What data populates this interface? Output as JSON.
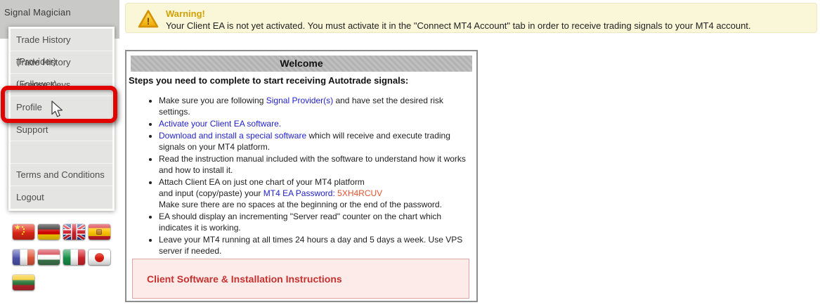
{
  "app": {
    "title": "Signal Magician"
  },
  "sidebar": {
    "items": [
      {
        "label": "Trade History (Provider)"
      },
      {
        "label": "Trade History (Follower)"
      },
      {
        "label": "License Keys"
      },
      {
        "label": "Profile",
        "highlighted": true
      },
      {
        "label": "Support"
      },
      {
        "label": ""
      },
      {
        "label": "Terms and Conditions"
      },
      {
        "label": "Logout"
      }
    ],
    "flags": [
      "china-flag-icon",
      "germany-flag-icon",
      "uk-flag-icon",
      "spain-flag-icon",
      "france-flag-icon",
      "hungary-flag-icon",
      "italy-flag-icon",
      "japan-flag-icon",
      "lithuania-flag-icon"
    ]
  },
  "warning": {
    "title": "Warning!",
    "message": "Your Client EA is not yet activated. You must activate it in the \"Connect MT4 Account\" tab in order to receive trading signals to your MT4 account."
  },
  "main": {
    "title": "Welcome",
    "intro": "Steps you need to complete to start receiving Autotrade signals:",
    "steps": [
      {
        "segments": [
          {
            "type": "text",
            "value": "Make sure you are following "
          },
          {
            "type": "link",
            "value": "Signal Provider(s)"
          },
          {
            "type": "text",
            "value": " and have set the desired risk settings."
          }
        ]
      },
      {
        "segments": [
          {
            "type": "link",
            "value": "Activate your Client EA software."
          }
        ]
      },
      {
        "segments": [
          {
            "type": "link",
            "value": "Download and install a special software"
          },
          {
            "type": "text",
            "value": " which will receive and execute trading signals on your MT4 platform."
          }
        ]
      },
      {
        "segments": [
          {
            "type": "text",
            "value": "Read the instruction manual included with the software to understand how it works and how to install it."
          }
        ]
      },
      {
        "segments": [
          {
            "type": "text",
            "value": "Attach Client EA on just one chart of your MT4 platform"
          },
          {
            "type": "break"
          },
          {
            "type": "text",
            "value": "and input (copy/paste) your "
          },
          {
            "type": "link",
            "value": "MT4 EA Password:"
          },
          {
            "type": "text",
            "value": " "
          },
          {
            "type": "password",
            "value": "5XH4RCUV"
          },
          {
            "type": "break"
          },
          {
            "type": "text",
            "value": "Make sure there are no spaces at the beginning or the end of the password."
          }
        ]
      },
      {
        "segments": [
          {
            "type": "text",
            "value": "EA should display an incrementing \"Server read\" counter on the chart which indicates it is working."
          }
        ]
      },
      {
        "segments": [
          {
            "type": "text",
            "value": "Leave your MT4 running at all times 24 hours a day and 5 days a week. Use VPS server if needed."
          }
        ]
      }
    ],
    "footer_box": {
      "label": "Client Software & Installation Instructions"
    }
  },
  "colors": {
    "link_blue": "#2222cc",
    "password_red": "#e4532f",
    "warning_bg": "#faf7d8",
    "warning_title": "#d2a000",
    "heading_red": "#c5312f",
    "highlight_red": "#e00500",
    "welcome_bar_gray": "#b8b8b8",
    "sidebar_band_gray": "#c9c9c7"
  }
}
